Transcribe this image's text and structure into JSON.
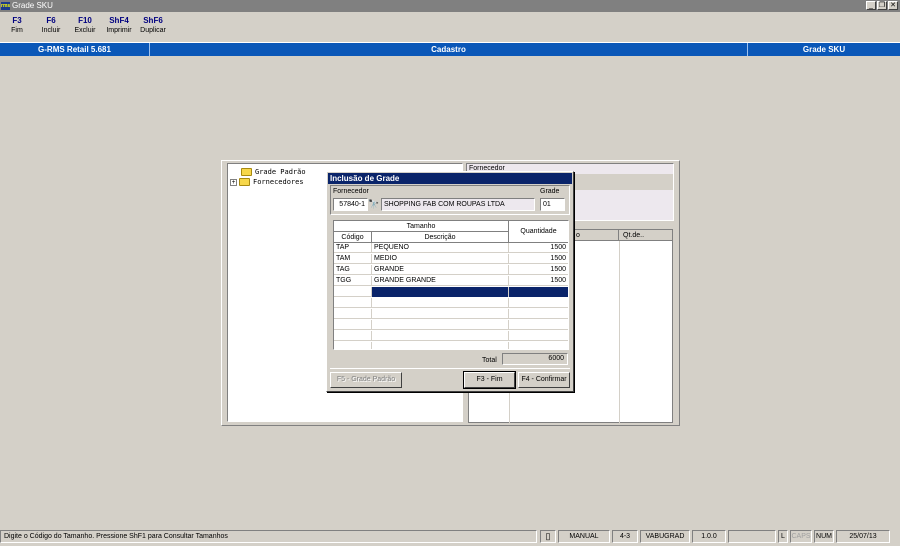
{
  "window": {
    "title": "Grade SKU",
    "icon_label": "rms"
  },
  "fkeys": [
    {
      "key": "F3",
      "label": "Fim"
    },
    {
      "key": "F6",
      "label": "Incluir"
    },
    {
      "key": "F10",
      "label": "Excluir"
    },
    {
      "key": "ShF4",
      "label": "Imprimir"
    },
    {
      "key": "ShF6",
      "label": "Duplicar"
    }
  ],
  "header": {
    "product": "G-RMS Retail 5.681",
    "section": "Cadastro",
    "screen": "Grade SKU"
  },
  "tree": {
    "items": [
      {
        "label": "Grade Padrão"
      },
      {
        "label": "Fornecedores",
        "expander": "+"
      }
    ]
  },
  "right_panel": {
    "fornecedor_label": "Fornecedor",
    "columns": [
      "o",
      "Qt.de.."
    ]
  },
  "dialog": {
    "title": "Inclusão de Grade",
    "fornecedor_label": "Fornecedor",
    "fornecedor_code": "57840-1",
    "fornecedor_name": "SHOPPING FAB COM ROUPAS LTDA",
    "grade_label": "Grade",
    "grade_value": "01",
    "table": {
      "group_header": "Tamanho",
      "col_codigo": "Código",
      "col_descricao": "Descrição",
      "col_quantidade": "Quantidade",
      "rows": [
        {
          "codigo": "TAP",
          "descricao": "PEQUENO",
          "quantidade": "1500"
        },
        {
          "codigo": "TAM",
          "descricao": "MEDIO",
          "quantidade": "1500"
        },
        {
          "codigo": "TAG",
          "descricao": "GRANDE",
          "quantidade": "1500"
        },
        {
          "codigo": "TGG",
          "descricao": "GRANDE GRANDE",
          "quantidade": "1500"
        }
      ]
    },
    "total_label": "Total",
    "total_value": "6000",
    "btn_grade_padrao": "F5 - Grade Padrão",
    "btn_fim": "F3 - Fim",
    "btn_confirmar": "F4 - Confirmar"
  },
  "status": {
    "message": "Digite o Código do Tamanho. Pressione ShF1 para Consultar Tamanhos",
    "mode": "MANUAL",
    "version_code": "4-3",
    "program": "VABUGRAD",
    "version": "1.0.0",
    "l": "L",
    "caps": "CAPS",
    "num": "NUM",
    "date": "25/07/13"
  }
}
